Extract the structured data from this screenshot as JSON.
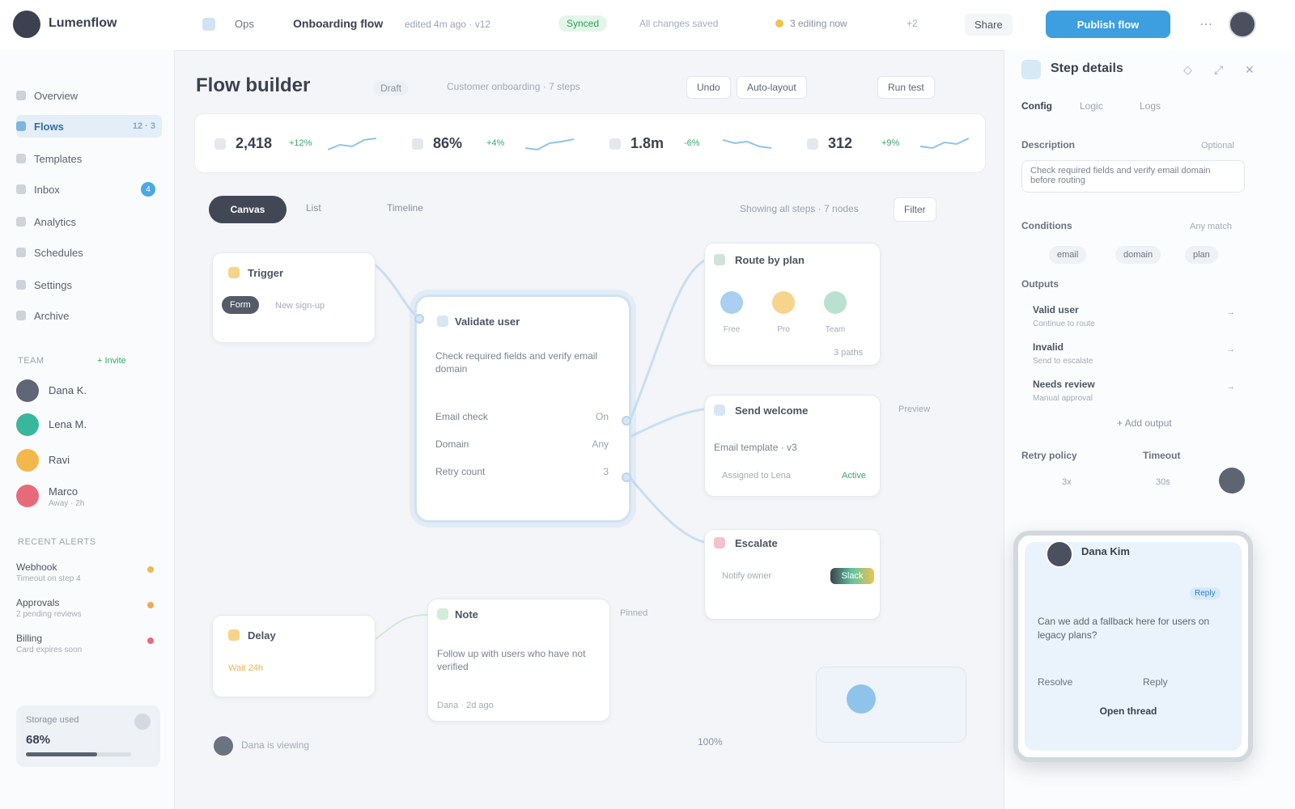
{
  "app": {
    "name": "Lumenflow",
    "logo_icon": "logo-icon"
  },
  "header": {
    "workspace": "Ops",
    "document": "Onboarding flow",
    "meta": "edited 4m ago · v12",
    "sync_status": "Synced",
    "saved": "All changes saved",
    "presence": "3 editing now",
    "presence_more": "+2",
    "share": "Share",
    "publish": "Publish flow",
    "more": "⋯"
  },
  "sidebar": {
    "items": [
      {
        "label": "Overview",
        "icon": "home-icon"
      },
      {
        "label": "Flows",
        "icon": "flow-icon",
        "count": "12 · 3",
        "active": true
      },
      {
        "label": "Templates",
        "icon": "template-icon"
      },
      {
        "label": "Inbox",
        "icon": "inbox-icon",
        "badge": "4"
      },
      {
        "label": "Analytics",
        "icon": "chart-icon"
      },
      {
        "label": "Schedules",
        "icon": "calendar-icon"
      },
      {
        "label": "Settings",
        "icon": "gear-icon"
      },
      {
        "label": "Archive",
        "icon": "archive-icon"
      }
    ],
    "team_heading": "TEAM",
    "team_link": "+ Invite",
    "team": [
      {
        "name": "Dana K.",
        "sub": "",
        "color": "#5f6675"
      },
      {
        "name": "Lena M.",
        "sub": "",
        "color": "#39b79a"
      },
      {
        "name": "Ravi",
        "sub": "",
        "color": "#f2b84b"
      },
      {
        "name": "Marco",
        "sub": "Away · 2h",
        "color": "#e86a7a"
      }
    ],
    "alerts_heading": "RECENT ALERTS",
    "alerts": [
      {
        "title": "Webhook",
        "sub": "Timeout on step 4",
        "color": "#f2b84b"
      },
      {
        "title": "Approvals",
        "sub": "2 pending reviews",
        "color": "#f2a85b"
      },
      {
        "title": "Billing",
        "sub": "Card expires soon",
        "color": "#e86a7a"
      }
    ],
    "storage": {
      "label": "Storage used",
      "value": "68%",
      "progress": 0.68
    }
  },
  "main": {
    "title": "Flow builder",
    "tag": "Draft",
    "description": "Customer onboarding · 7 steps",
    "tools": [
      "Undo",
      "Auto-layout",
      "Run test"
    ],
    "stats": [
      {
        "value": "2,418",
        "delta": "+12%"
      },
      {
        "value": "86%",
        "delta": "+4%"
      },
      {
        "value": "1.8m",
        "delta": "-6%"
      },
      {
        "value": "312",
        "delta": "+9%"
      }
    ],
    "segments": {
      "active": "Canvas",
      "others": [
        "List",
        "Timeline"
      ]
    },
    "filter_text": "Showing all steps · 7 nodes",
    "filter_btn": "Filter",
    "nodes": {
      "trigger": {
        "title": "Trigger",
        "chip": "Form",
        "sub": "New sign-up"
      },
      "center": {
        "title": "Validate user",
        "description": "Check required fields and verify email domain",
        "rows": [
          {
            "k": "Email check",
            "v": "On"
          },
          {
            "k": "Domain",
            "v": "Any"
          },
          {
            "k": "Retry count",
            "v": "3"
          }
        ]
      },
      "route": {
        "title": "Route by plan",
        "options": [
          "Free",
          "Pro",
          "Team"
        ],
        "note": "3 paths"
      },
      "welcome": {
        "title": "Send welcome",
        "sub": "Email template · v3",
        "owner": "Assigned to Lena",
        "tag": "Active",
        "side_note": "Preview"
      },
      "escalate": {
        "title": "Escalate",
        "sub": "Notify owner",
        "badge": "Slack"
      },
      "delay": {
        "title": "Delay",
        "sub": "Wait 24h"
      },
      "note": {
        "title": "Note",
        "text": "Follow up with users who have not verified",
        "meta": "Dana · 2d ago",
        "side": "Pinned"
      }
    },
    "footer": {
      "text": "Dana is viewing",
      "zoom": "100%"
    }
  },
  "panel": {
    "title": "Step details",
    "tabs": [
      "Config",
      "Logic",
      "Logs"
    ],
    "description_label": "Description",
    "description_hint": "Optional",
    "description_value": "Check required fields and verify email domain before routing",
    "conditions_label": "Conditions",
    "conditions_hint": "Any match",
    "chips": [
      "email",
      "domain",
      "plan"
    ],
    "outputs_label": "Outputs",
    "outputs": [
      {
        "title": "Valid user",
        "sub": "Continue to route",
        "val": "→"
      },
      {
        "title": "Invalid",
        "sub": "Send to escalate",
        "val": "→"
      },
      {
        "title": "Needs review",
        "sub": "Manual approval",
        "val": "→"
      }
    ],
    "add_output": "+ Add output",
    "col_heads": [
      "Retry policy",
      "Timeout"
    ],
    "minis": [
      "3x",
      "30s"
    ],
    "chat": {
      "name": "Dana Kim",
      "tag": "Reply",
      "message": "Can we add a fallback here for users on legacy plans?",
      "replies": [
        "Resolve",
        "Reply"
      ],
      "cta": "Open thread"
    }
  }
}
